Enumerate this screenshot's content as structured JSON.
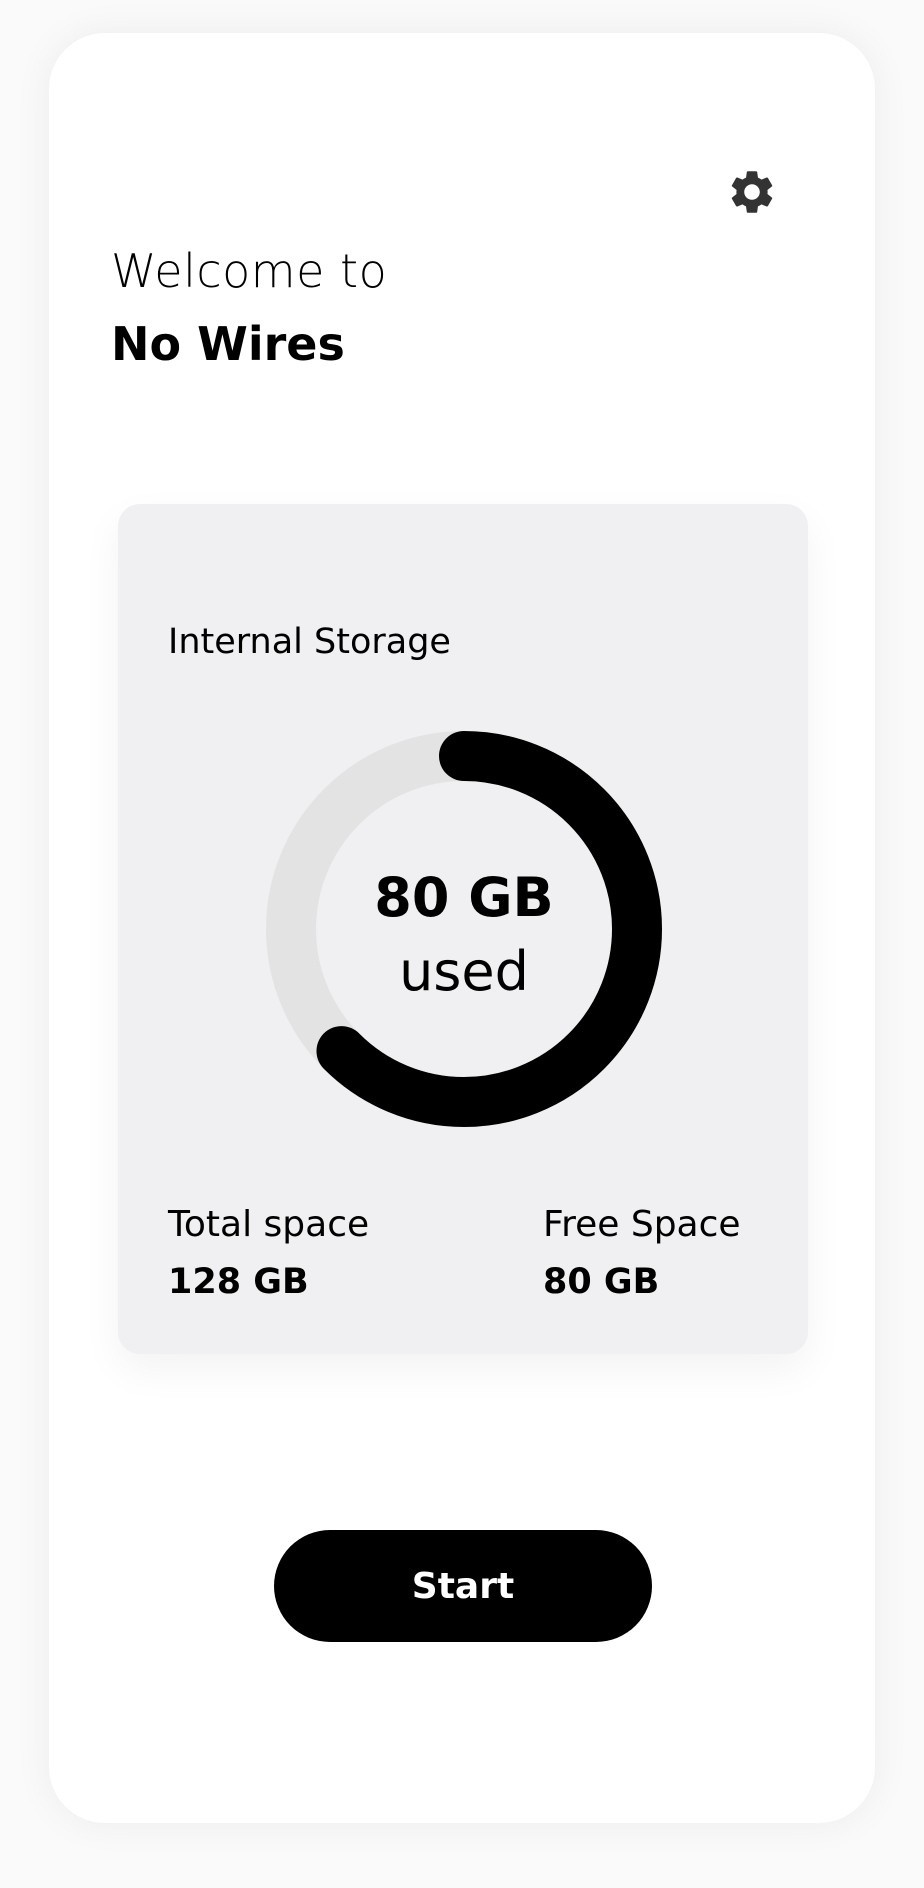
{
  "header": {
    "welcome": "Welcome to",
    "app_name": "No Wires",
    "settings_icon": "gear-icon"
  },
  "storage": {
    "title": "Internal Storage",
    "used_value": "80 GB",
    "used_caption": "used",
    "used_fraction": 0.625,
    "total_label": "Total space",
    "total_value": "128 GB",
    "free_label": "Free Space",
    "free_value": "80 GB"
  },
  "actions": {
    "start_label": "Start"
  },
  "colors": {
    "background": "#fafafa",
    "card": "#f0f0f2",
    "ring_track": "#e3e3e3",
    "ring_fill": "#000000",
    "button": "#000000",
    "button_text": "#ffffff"
  }
}
